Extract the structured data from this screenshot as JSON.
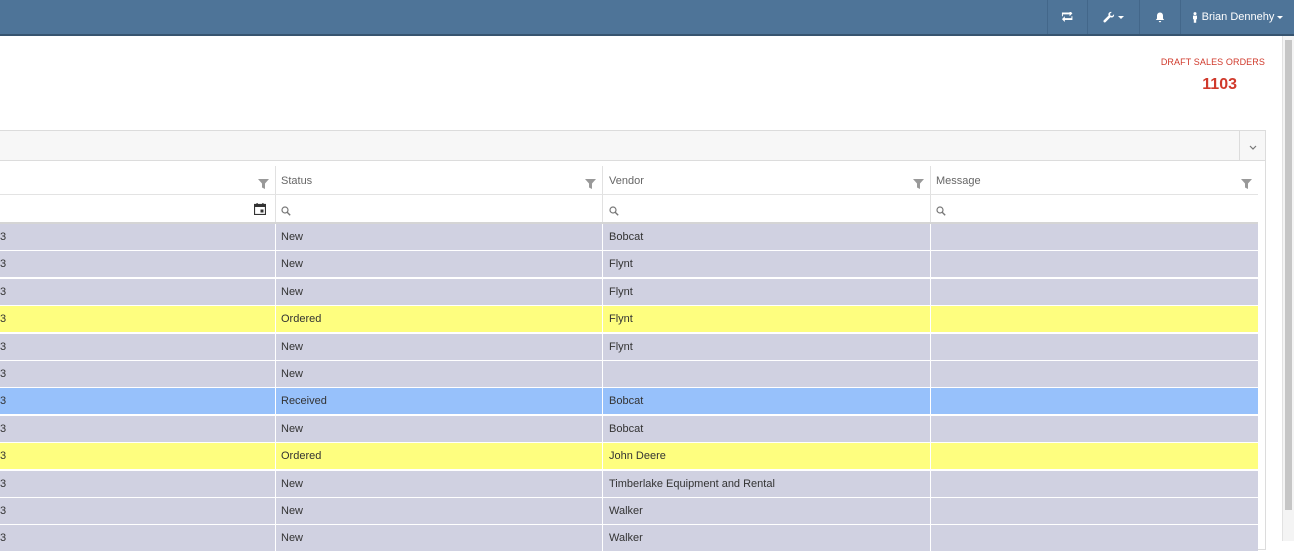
{
  "header": {
    "user_name": "Brian Dennehy",
    "icons": [
      "sync-icon",
      "wrench-icon",
      "bell-icon",
      "user-icon"
    ]
  },
  "kpi": {
    "label": "DRAFT SALES ORDERS",
    "value": "1103",
    "color": "#d0392b"
  },
  "grid": {
    "columns": [
      {
        "label": ""
      },
      {
        "label": "Status"
      },
      {
        "label": "Vendor"
      },
      {
        "label": "Message"
      }
    ],
    "row_colors": {
      "New": "#d0d1e1",
      "Ordered": "#fefe7f",
      "Received": "#97c1fb"
    },
    "rows": [
      {
        "first": "3",
        "status": "New",
        "vendor": "Bobcat",
        "message": ""
      },
      {
        "first": "3",
        "status": "New",
        "vendor": "Flynt",
        "message": ""
      },
      {
        "first": "3",
        "status": "New",
        "vendor": "Flynt",
        "message": ""
      },
      {
        "first": "3",
        "status": "Ordered",
        "vendor": "Flynt",
        "message": ""
      },
      {
        "first": "3",
        "status": "New",
        "vendor": "Flynt",
        "message": ""
      },
      {
        "first": "3",
        "status": "New",
        "vendor": "",
        "message": ""
      },
      {
        "first": "3",
        "status": "Received",
        "vendor": "Bobcat",
        "message": ""
      },
      {
        "first": "3",
        "status": "New",
        "vendor": "Bobcat",
        "message": ""
      },
      {
        "first": "3",
        "status": "Ordered",
        "vendor": "John Deere",
        "message": ""
      },
      {
        "first": "3",
        "status": "New",
        "vendor": "Timberlake Equipment and Rental",
        "message": ""
      },
      {
        "first": "3",
        "status": "New",
        "vendor": "Walker",
        "message": ""
      },
      {
        "first": "3",
        "status": "New",
        "vendor": "Walker",
        "message": ""
      }
    ]
  }
}
